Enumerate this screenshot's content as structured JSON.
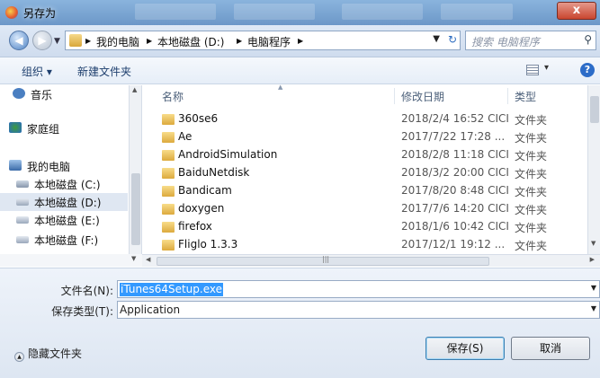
{
  "window": {
    "title": "另存为",
    "close_label": "x"
  },
  "address": {
    "crumbs": [
      "我的电脑",
      "本地磁盘 (D:)",
      "电脑程序"
    ],
    "separator": "▶",
    "search_placeholder": "搜索 电脑程序"
  },
  "toolbar": {
    "organize_label": "组织 ▾",
    "new_folder_label": "新建文件夹"
  },
  "nav": {
    "items": [
      {
        "label": "音乐",
        "icon": "music-icon"
      },
      {
        "label": "家庭组",
        "icon": "homegroup-icon"
      },
      {
        "label": "我的电脑",
        "icon": "computer-icon"
      },
      {
        "label": "本地磁盘 (C:)",
        "icon": "drive-icon"
      },
      {
        "label": "本地磁盘 (D:)",
        "icon": "drive-icon"
      },
      {
        "label": "本地磁盘 (E:)",
        "icon": "drive-icon"
      },
      {
        "label": "本地磁盘 (F:)",
        "icon": "drive-icon"
      }
    ]
  },
  "columns": {
    "name": "名称",
    "date": "修改日期",
    "type": "类型"
  },
  "files": [
    {
      "name": "360se6",
      "date": "2018/2/4 16:52 CICI",
      "type": "文件夹"
    },
    {
      "name": "Ae",
      "date": "2017/7/22 17:28 ...",
      "type": "文件夹"
    },
    {
      "name": "AndroidSimulation",
      "date": "2018/2/8 11:18 CICI",
      "type": "文件夹"
    },
    {
      "name": "BaiduNetdisk",
      "date": "2018/3/2 20:00 CICI",
      "type": "文件夹"
    },
    {
      "name": "Bandicam",
      "date": "2017/8/20 8:48 CICI",
      "type": "文件夹"
    },
    {
      "name": "doxygen",
      "date": "2017/7/6 14:20 CICI",
      "type": "文件夹"
    },
    {
      "name": "firefox",
      "date": "2018/1/6 10:42 CICI",
      "type": "文件夹"
    },
    {
      "name": "Fliglo 1.3.3",
      "date": "2017/12/1 19:12 ...",
      "type": "文件夹"
    }
  ],
  "form": {
    "filename_label": "文件名(N):",
    "filename_value": "iTunes64Setup.exe",
    "filetype_label": "保存类型(T):",
    "filetype_value": "Application"
  },
  "buttons": {
    "hide_folders": "隐藏文件夹",
    "save": "保存(S)",
    "cancel": "取消"
  },
  "colors": {
    "selection": "#3399ff",
    "titlebar": "#6c97c8",
    "close": "#c9462f"
  }
}
